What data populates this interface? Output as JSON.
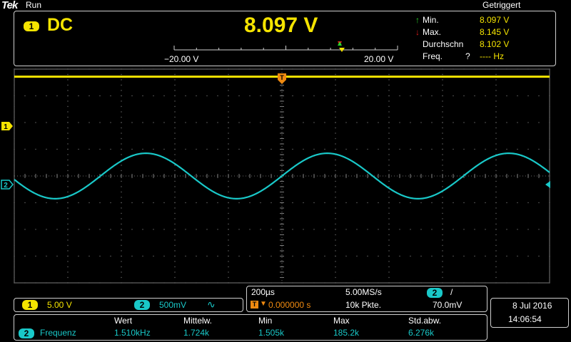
{
  "brand": "Tek",
  "run_state": "Run",
  "trigger_status": "Getriggert",
  "dvm": {
    "channel": "1",
    "coupling": "DC",
    "reading": "8.097 V",
    "scale_min": "−20.00 V",
    "scale_max": "20.00 V",
    "stats": [
      {
        "label": "Min.",
        "value": "8.097 V"
      },
      {
        "label": "Max.",
        "value": "8.145 V"
      },
      {
        "label": "Durchschn",
        "value": "8.102 V"
      },
      {
        "label": "Freq.",
        "flag": "?",
        "value": "---- Hz"
      }
    ]
  },
  "markers": {
    "ch1": "1",
    "ch2": "2",
    "trigger": "T"
  },
  "channels": {
    "ch1": {
      "num": "1",
      "scale": "5.00 V",
      "color": "#f5e400"
    },
    "ch2": {
      "num": "2",
      "scale": "500mV",
      "coupling_icon": "∿",
      "color": "#19c8c8"
    }
  },
  "timebase": {
    "time_div": "200µs",
    "sample_rate": "5.00MS/s",
    "trigger_pos": "0.000000 s",
    "record_length": "10k Pkte.",
    "trig_channel": "2",
    "trig_slope": "/",
    "trig_level": "70.0mV"
  },
  "datetime": {
    "date": "8 Jul  2016",
    "time": "14:06:54"
  },
  "measurements": {
    "headers": [
      "Wert",
      "Mittelw.",
      "Min",
      "Max",
      "Std.abw."
    ],
    "rows": [
      {
        "channel": "2",
        "name": "Frequenz",
        "values": [
          "1.510kHz",
          "1.724k",
          "1.505k",
          "185.2k",
          "6.276k"
        ]
      }
    ]
  },
  "waveform": {
    "ch2_cycles": 2.95,
    "ch2_amplitude_div": 0.85,
    "ch1_level_div": 1.85
  }
}
